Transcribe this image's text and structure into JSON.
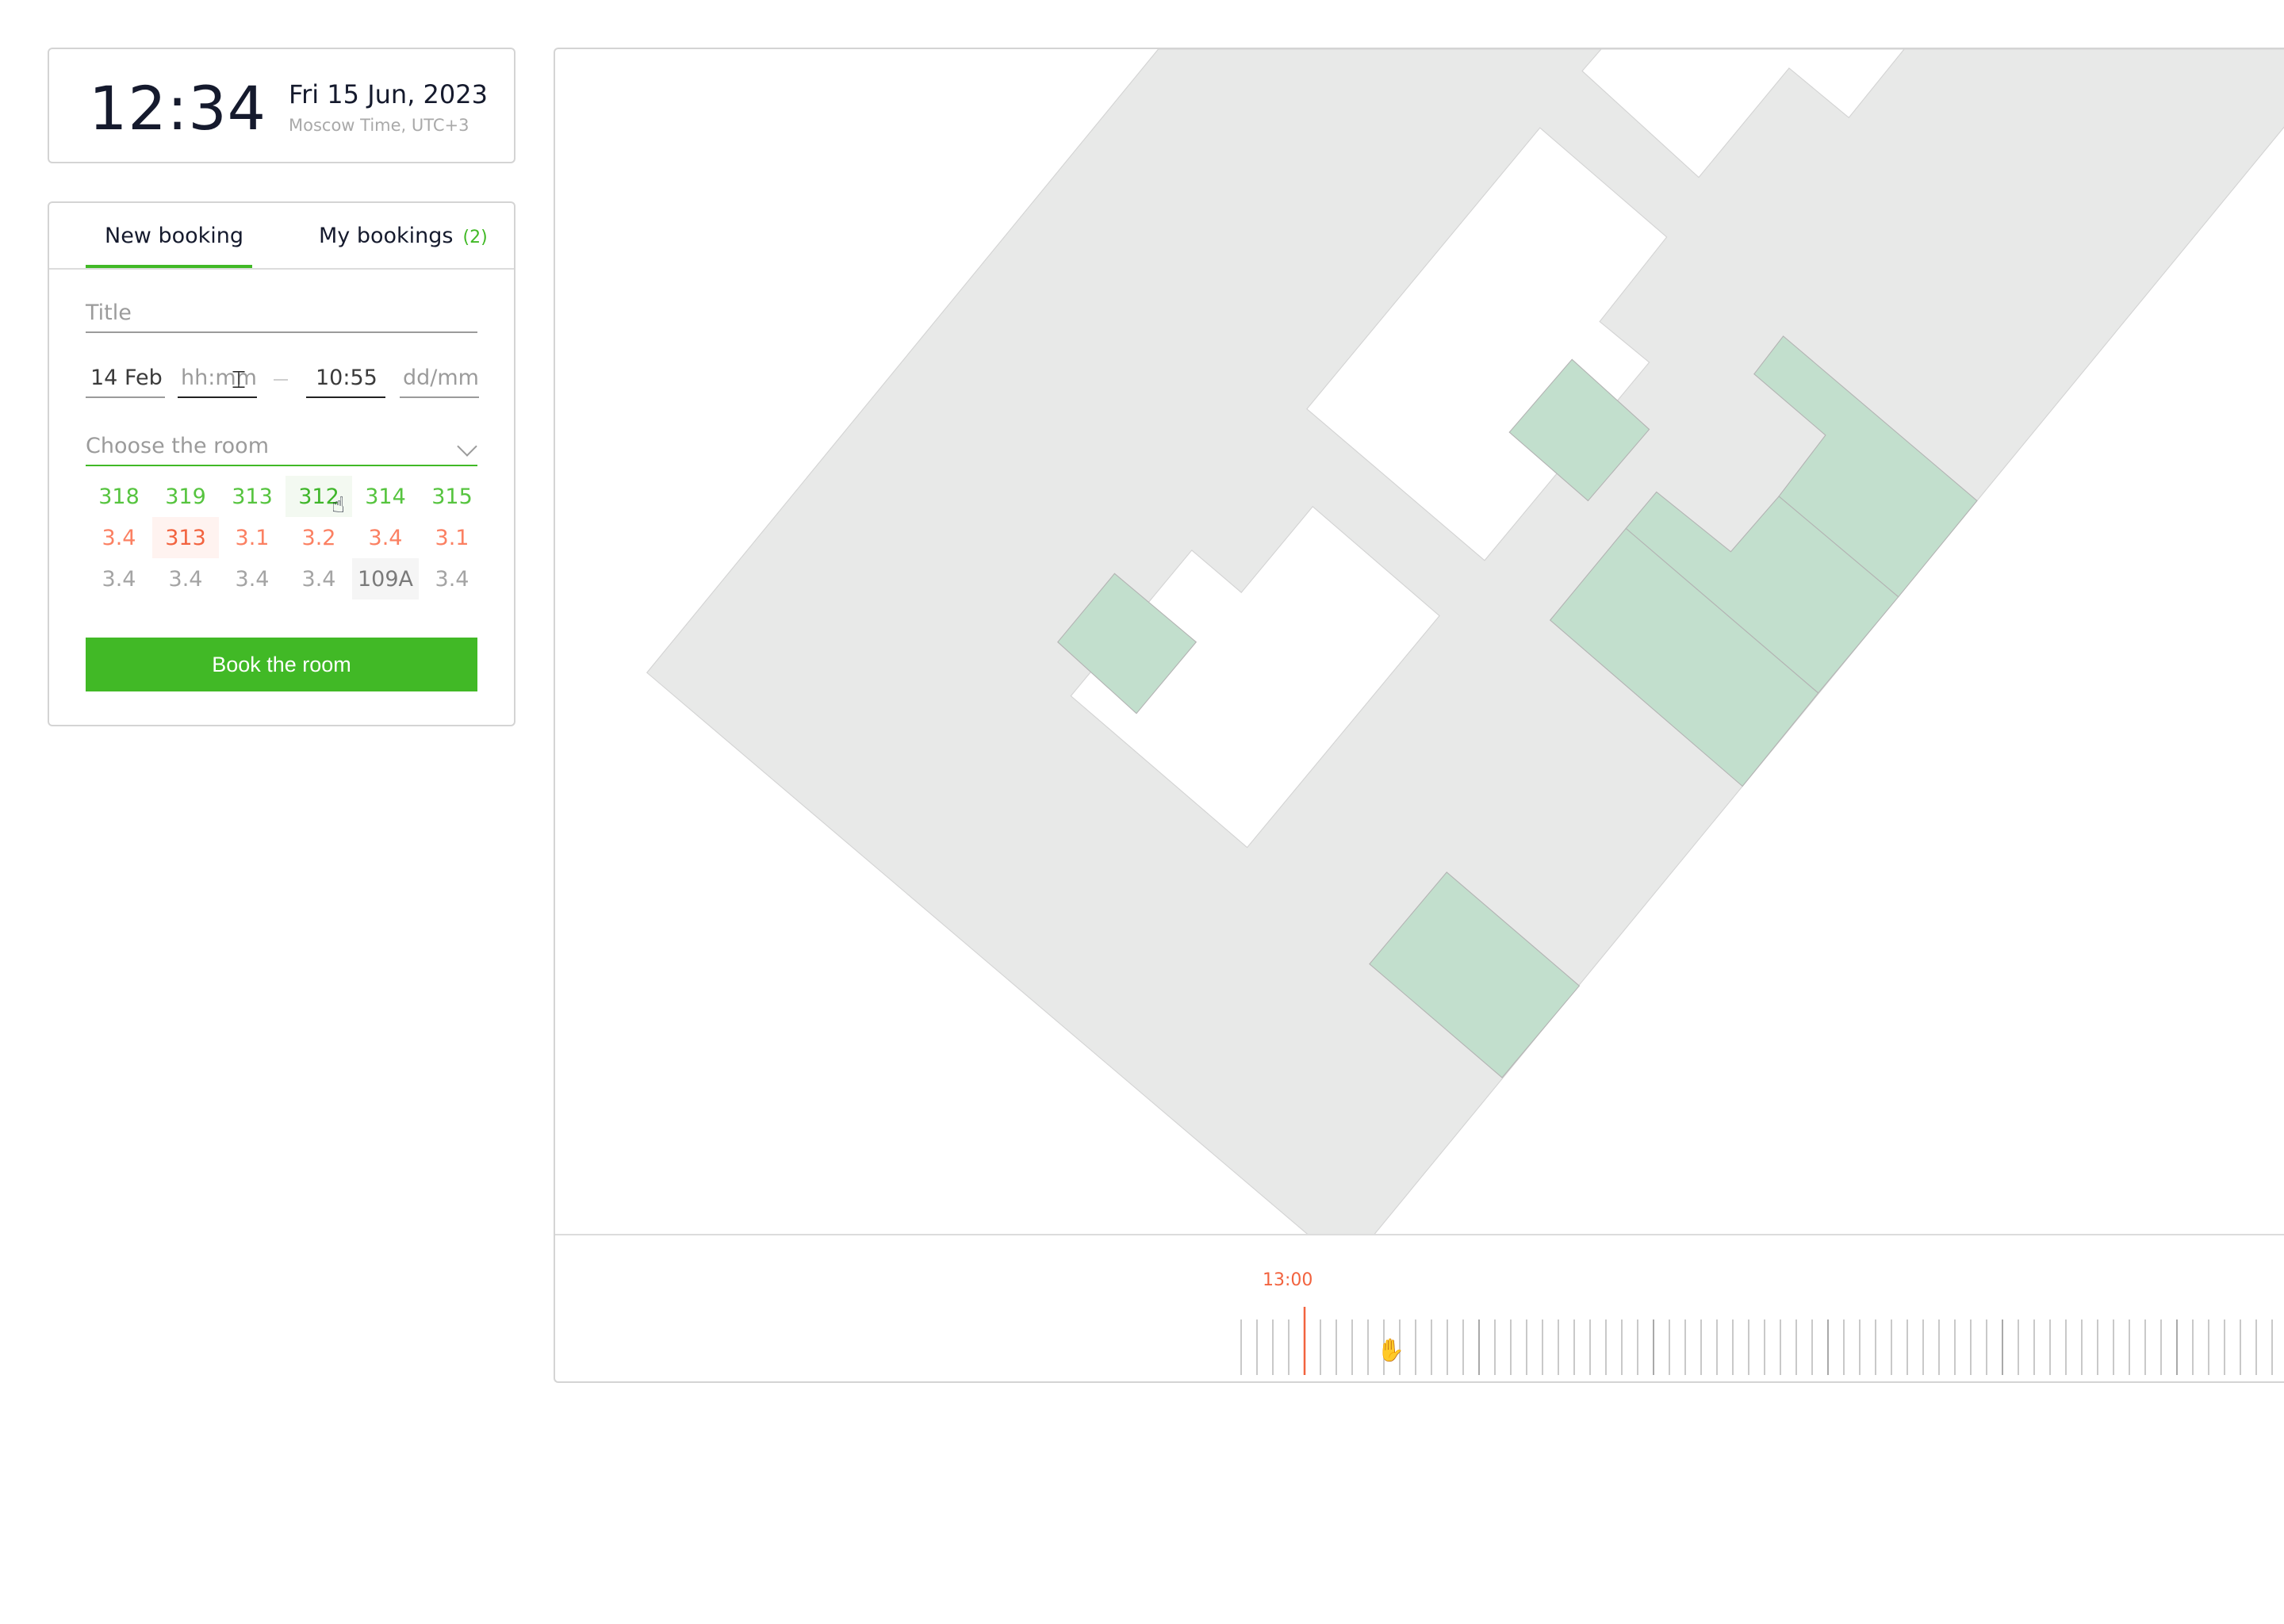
{
  "clock": {
    "time": "12:34",
    "date": "Fri 15 Jun, 2023",
    "timezone": "Moscow Time, UTC+3"
  },
  "booking": {
    "tabs": [
      {
        "label": "New booking",
        "active": true
      },
      {
        "label": "My bookings",
        "badge": "(2)",
        "active": false
      }
    ],
    "title_placeholder": "Title",
    "start_date": "14 Feb",
    "start_time_placeholder": "hh:mm",
    "end_time": "10:55",
    "end_date_placeholder": "dd/mm",
    "room_placeholder": "Choose the room",
    "rooms": [
      [
        {
          "label": "318",
          "status": "free"
        },
        {
          "label": "319",
          "status": "free"
        },
        {
          "label": "313",
          "status": "free"
        },
        {
          "label": "312",
          "status": "free",
          "hovered": true
        },
        {
          "label": "314",
          "status": "free"
        },
        {
          "label": "315",
          "status": "free"
        }
      ],
      [
        {
          "label": "3.4",
          "status": "busy"
        },
        {
          "label": "313",
          "status": "busy",
          "hovered": true
        },
        {
          "label": "3.1",
          "status": "busy"
        },
        {
          "label": "3.2",
          "status": "busy"
        },
        {
          "label": "3.4",
          "status": "busy"
        },
        {
          "label": "3.1",
          "status": "busy"
        }
      ],
      [
        {
          "label": "3.4",
          "status": "unavailable"
        },
        {
          "label": "3.4",
          "status": "unavailable"
        },
        {
          "label": "3.4",
          "status": "unavailable"
        },
        {
          "label": "3.4",
          "status": "unavailable"
        },
        {
          "label": "109A",
          "status": "unavailable",
          "hovered": true
        },
        {
          "label": "3.4",
          "status": "unavailable"
        }
      ]
    ],
    "book_button": "Book the room"
  },
  "colors": {
    "accent": "#41b926",
    "busy": "#fb8062",
    "unavailable": "#a4a4a4",
    "floor": "#e8e9e8",
    "room_free": "#c2dfcd",
    "now_marker": "#f2633f"
  },
  "timeline": {
    "now_label": "13:00",
    "ticks_before_now": 4,
    "ticks_per_major": 11
  },
  "icons": {
    "dropdown": "chevron-down-icon",
    "cursor_text": "text-cursor-icon",
    "cursor_pointer": "hand-pointer-icon",
    "cursor_grab": "hand-grab-icon"
  }
}
